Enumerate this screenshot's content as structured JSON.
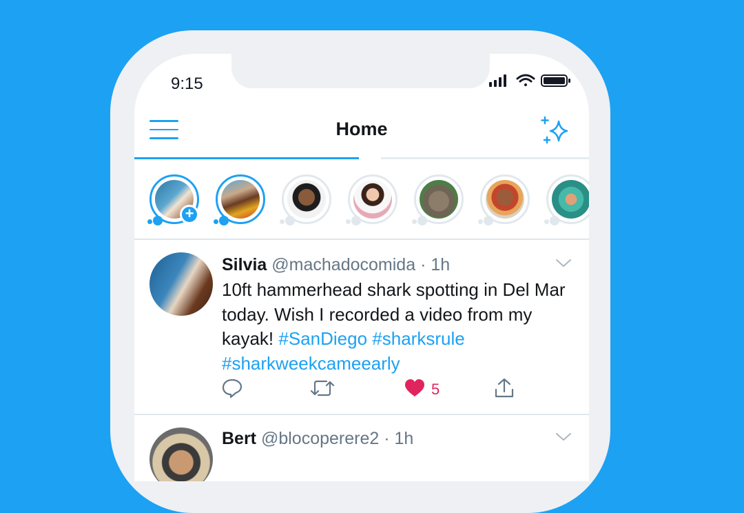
{
  "status_bar": {
    "time": "9:15"
  },
  "header": {
    "title": "Home"
  },
  "fleets": [
    {
      "name": "your-fleet",
      "seen": false
    },
    {
      "name": "fleet-2",
      "seen": false
    },
    {
      "name": "fleet-3",
      "seen": true
    },
    {
      "name": "fleet-4",
      "seen": true
    },
    {
      "name": "fleet-5",
      "seen": true
    },
    {
      "name": "fleet-6",
      "seen": true
    },
    {
      "name": "fleet-7",
      "seen": true
    }
  ],
  "tweets": [
    {
      "name": "Silvia",
      "handle": "@machadocomida",
      "time": "· 1h",
      "text_plain": "10ft hammerhead shark spotting in Del Mar today. Wish I recorded a video from my kayak!",
      "tags": [
        "#SanDiego",
        "#sharksrule",
        "#sharkweekcameearly"
      ],
      "likes": "5"
    },
    {
      "name": "Bert",
      "handle": "@blocoperere2",
      "time": "· 1h"
    }
  ],
  "colors": {
    "accent": "#1da1f2",
    "like": "#e0245e",
    "background": "#1da1f2"
  }
}
